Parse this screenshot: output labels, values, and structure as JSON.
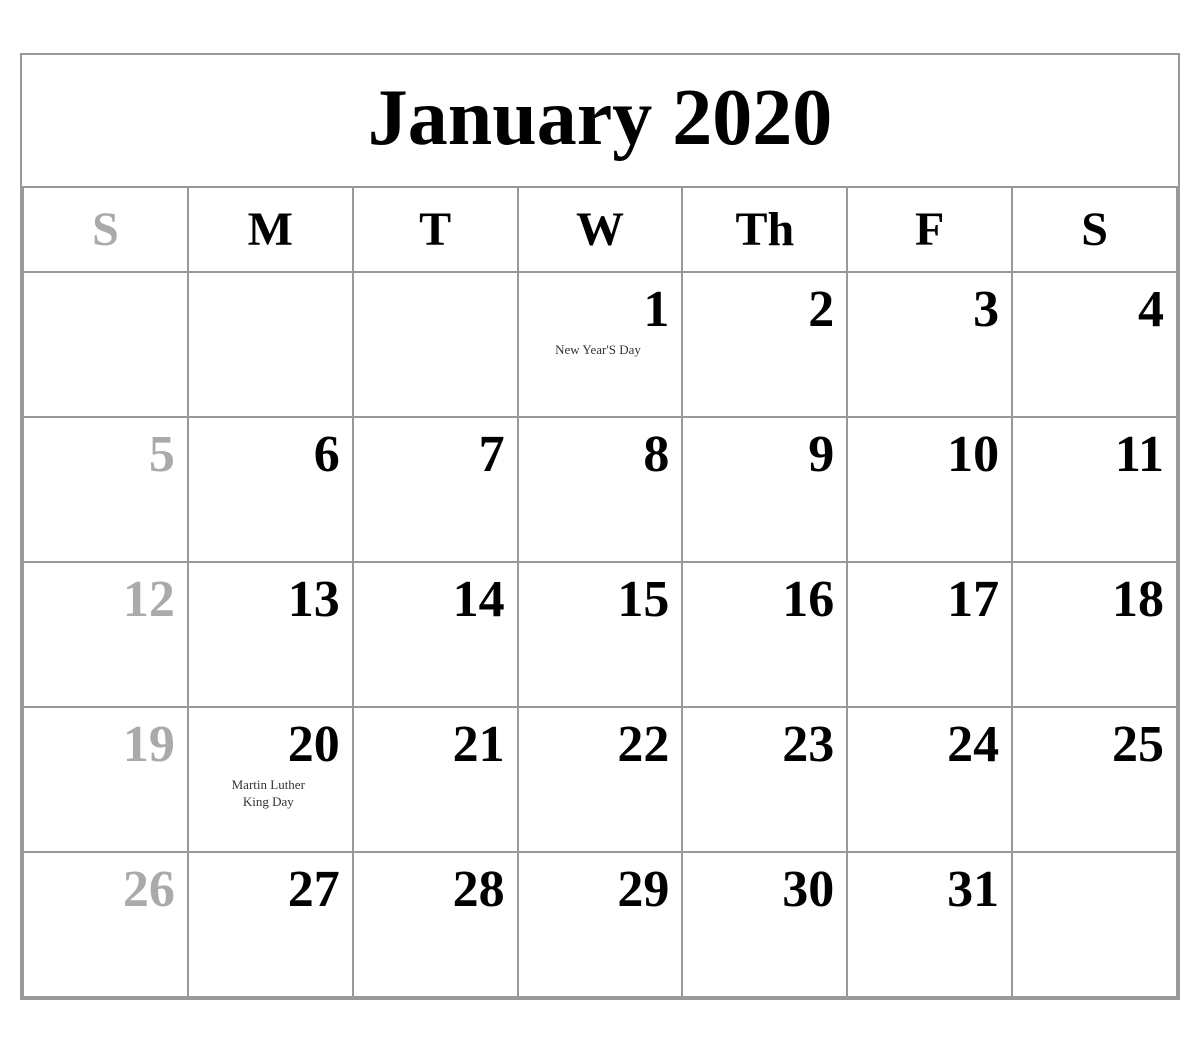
{
  "calendar": {
    "title": "January 2020",
    "headers": [
      {
        "label": "S",
        "isSunday": true
      },
      {
        "label": "M",
        "isSunday": false
      },
      {
        "label": "T",
        "isSunday": false
      },
      {
        "label": "W",
        "isSunday": false
      },
      {
        "label": "Th",
        "isSunday": false
      },
      {
        "label": "F",
        "isSunday": false
      },
      {
        "label": "S",
        "isSunday": false
      }
    ],
    "weeks": [
      [
        {
          "day": "",
          "empty": true,
          "sunday": true
        },
        {
          "day": "",
          "empty": true,
          "sunday": false
        },
        {
          "day": "",
          "empty": true,
          "sunday": false
        },
        {
          "day": "1",
          "empty": false,
          "sunday": false,
          "holiday": "New Year'S Day"
        },
        {
          "day": "2",
          "empty": false,
          "sunday": false
        },
        {
          "day": "3",
          "empty": false,
          "sunday": false
        },
        {
          "day": "4",
          "empty": false,
          "sunday": false
        }
      ],
      [
        {
          "day": "5",
          "empty": false,
          "sunday": true
        },
        {
          "day": "6",
          "empty": false,
          "sunday": false
        },
        {
          "day": "7",
          "empty": false,
          "sunday": false
        },
        {
          "day": "8",
          "empty": false,
          "sunday": false
        },
        {
          "day": "9",
          "empty": false,
          "sunday": false
        },
        {
          "day": "10",
          "empty": false,
          "sunday": false
        },
        {
          "day": "11",
          "empty": false,
          "sunday": false
        }
      ],
      [
        {
          "day": "12",
          "empty": false,
          "sunday": true
        },
        {
          "day": "13",
          "empty": false,
          "sunday": false
        },
        {
          "day": "14",
          "empty": false,
          "sunday": false
        },
        {
          "day": "15",
          "empty": false,
          "sunday": false
        },
        {
          "day": "16",
          "empty": false,
          "sunday": false
        },
        {
          "day": "17",
          "empty": false,
          "sunday": false
        },
        {
          "day": "18",
          "empty": false,
          "sunday": false
        }
      ],
      [
        {
          "day": "19",
          "empty": false,
          "sunday": true
        },
        {
          "day": "20",
          "empty": false,
          "sunday": false,
          "holiday": "Martin Luther\nKing Day"
        },
        {
          "day": "21",
          "empty": false,
          "sunday": false
        },
        {
          "day": "22",
          "empty": false,
          "sunday": false
        },
        {
          "day": "23",
          "empty": false,
          "sunday": false
        },
        {
          "day": "24",
          "empty": false,
          "sunday": false
        },
        {
          "day": "25",
          "empty": false,
          "sunday": false
        }
      ],
      [
        {
          "day": "26",
          "empty": false,
          "sunday": true
        },
        {
          "day": "27",
          "empty": false,
          "sunday": false
        },
        {
          "day": "28",
          "empty": false,
          "sunday": false
        },
        {
          "day": "29",
          "empty": false,
          "sunday": false
        },
        {
          "day": "30",
          "empty": false,
          "sunday": false
        },
        {
          "day": "31",
          "empty": false,
          "sunday": false
        },
        {
          "day": "",
          "empty": true,
          "sunday": false
        }
      ]
    ]
  }
}
